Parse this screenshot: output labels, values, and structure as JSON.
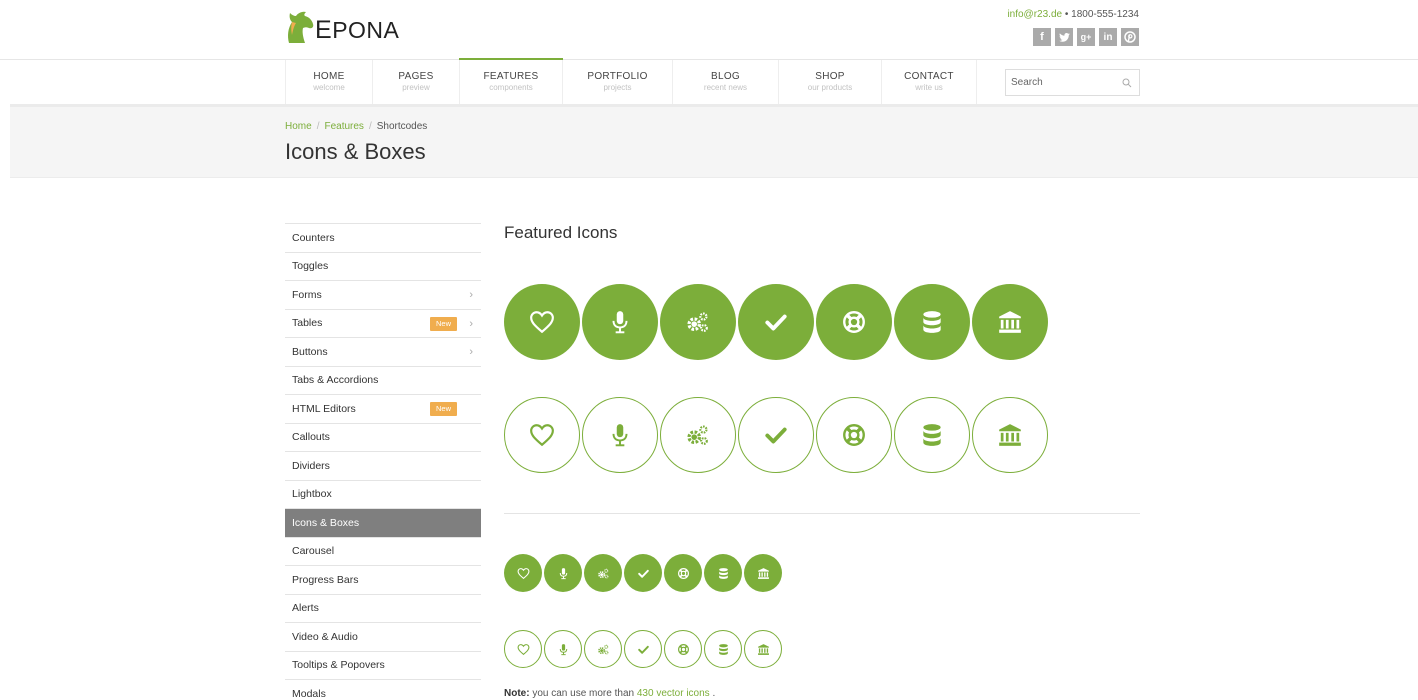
{
  "brand": {
    "name_first": "E",
    "name_rest": "PONA"
  },
  "contact": {
    "email": "info@r23.de",
    "separator": "•",
    "phone": "1800-555-1234"
  },
  "social": [
    "f",
    "t",
    "g+",
    "in",
    "p"
  ],
  "nav": [
    {
      "label": "HOME",
      "sub": "welcome"
    },
    {
      "label": "PAGES",
      "sub": "preview"
    },
    {
      "label": "FEATURES",
      "sub": "components",
      "active": true
    },
    {
      "label": "PORTFOLIO",
      "sub": "projects"
    },
    {
      "label": "BLOG",
      "sub": "recent news"
    },
    {
      "label": "SHOP",
      "sub": "our products"
    },
    {
      "label": "CONTACT",
      "sub": "write us"
    }
  ],
  "search": {
    "placeholder": "Search"
  },
  "breadcrumb": {
    "home": "Home",
    "sep": "/",
    "features": "Features",
    "current": "Shortcodes"
  },
  "page_title": "Icons & Boxes",
  "sidebar": [
    {
      "label": "Counters"
    },
    {
      "label": "Toggles"
    },
    {
      "label": "Forms",
      "arrow": true
    },
    {
      "label": "Tables",
      "badge": "New",
      "arrow": true
    },
    {
      "label": "Buttons",
      "arrow": true
    },
    {
      "label": "Tabs & Accordions"
    },
    {
      "label": "HTML Editors",
      "badge": "New"
    },
    {
      "label": "Callouts"
    },
    {
      "label": "Dividers"
    },
    {
      "label": "Lightbox"
    },
    {
      "label": "Icons & Boxes",
      "active": true
    },
    {
      "label": "Carousel"
    },
    {
      "label": "Progress Bars"
    },
    {
      "label": "Alerts"
    },
    {
      "label": "Video & Audio"
    },
    {
      "label": "Tooltips & Popovers"
    },
    {
      "label": "Modals"
    }
  ],
  "section_title": "Featured Icons",
  "icons": [
    "heart-icon",
    "microphone-icon",
    "cogs-icon",
    "check-icon",
    "life-ring-icon",
    "database-icon",
    "bank-icon"
  ],
  "note": {
    "bold": "Note:",
    "text": " you can use more than ",
    "link": "430 vector icons",
    "end": " ."
  },
  "colors": {
    "accent": "#7cae3a",
    "badge": "#f0ad4e",
    "active_sidebar": "#7f7f7f"
  }
}
